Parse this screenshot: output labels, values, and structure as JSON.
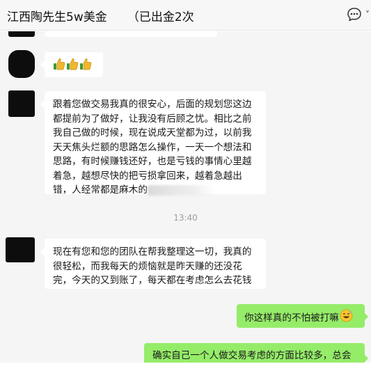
{
  "window": {
    "title": "江西陶先生5w美金\t（已出金2次",
    "more_icon": "chat-bubble-more-icon",
    "chevron_icon": "chevron-down-icon"
  },
  "messages": [
    {
      "side": "in",
      "text": ""
    },
    {
      "side": "in",
      "emoji": [
        "thumbs-up-icon",
        "thumbs-up-icon",
        "thumbs-up-icon"
      ]
    },
    {
      "side": "in",
      "text": "跟着您做交易我真的很安心，后面的规划您这边都提前为了做好，让我没有后顾之忧。相比之前我自己做的时候，现在说成天堂都为过，以前我天天焦头烂额的思路怎么操作，一天一个想法和思路，有时候赚钱还好，也是亏钱的事情心里越着急，越想尽快的把亏损拿回来，越着急越出错，人经常都是麻木的",
      "blurred_tail": true
    },
    {
      "side": "time",
      "text": "13:40"
    },
    {
      "side": "in",
      "text": "现在有您和您的团队在帮我整理这一切，我真的很轻松，而我每天的烦恼就是昨天赚的还没花完，今天的又到账了，每天都在考虑怎么去花钱"
    },
    {
      "side": "out",
      "text": "你这样真的不怕被打嘛",
      "emoji": "grinning-sweat-emoji"
    },
    {
      "side": "out",
      "text": "确实自己一个人做交易考虑的方面比较多，总会"
    }
  ],
  "colors": {
    "chat_background": "#f5f5f5",
    "outgoing_bubble": "#95ec69",
    "incoming_bubble": "#ffffff",
    "avatar": "#0d0d0d"
  }
}
